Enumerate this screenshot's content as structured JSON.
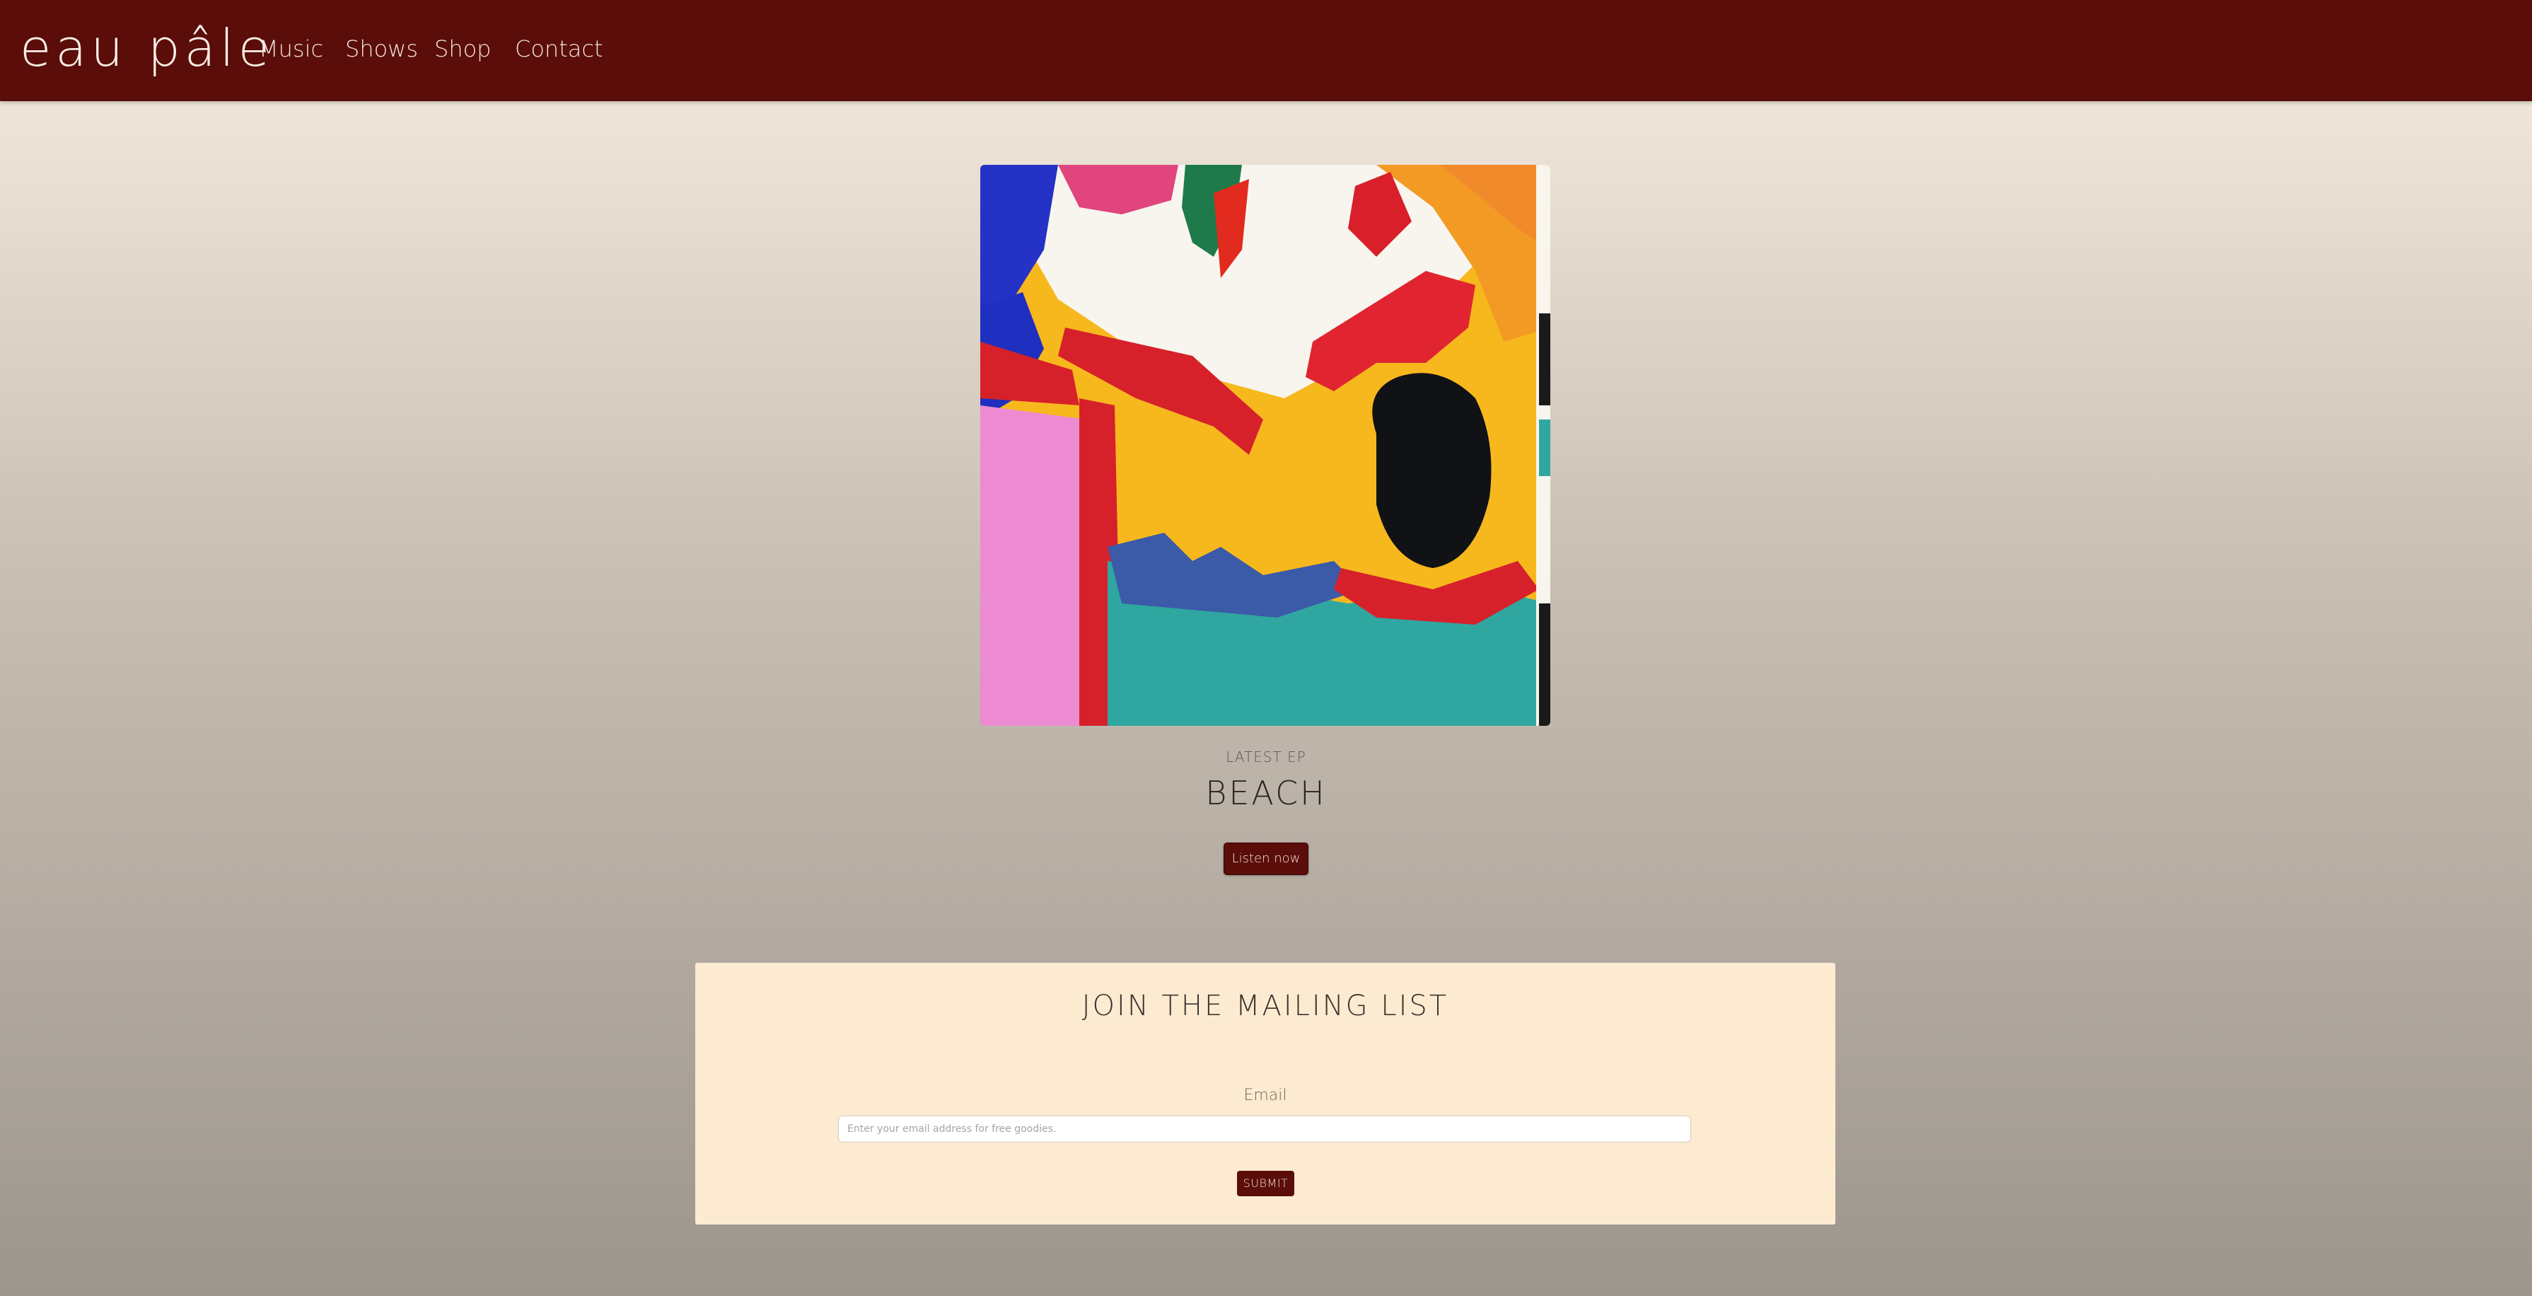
{
  "nav": {
    "brand": "eau pâle",
    "links": [
      "Music",
      "Shows",
      "Shop",
      "Contact"
    ]
  },
  "release": {
    "caption": "LATEST EP",
    "title": "BEACH",
    "cta_label": "Listen now",
    "cover_image_alt": "abstract-painting-album-cover"
  },
  "mailing_list": {
    "title": "JOIN THE MAILING LIST",
    "email_label": "Email",
    "email_placeholder": "Enter your email address for free goodies.",
    "email_value": "",
    "submit_label": "SUBMIT"
  },
  "colors": {
    "brand_dark_red": "#5a0d09",
    "form_background": "#fcebd0",
    "nav_text": "#f2e2dc"
  }
}
